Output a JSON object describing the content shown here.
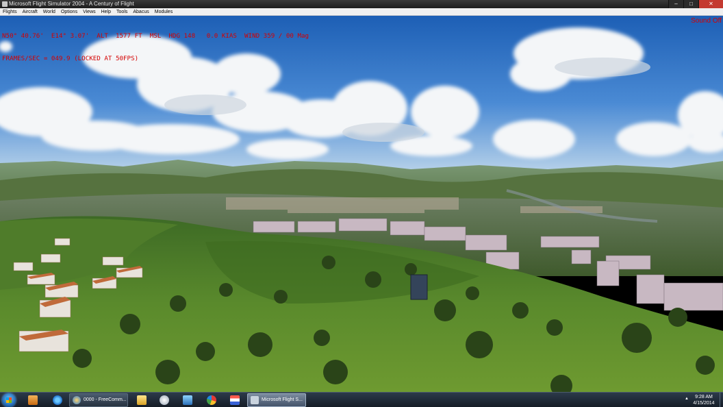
{
  "window": {
    "title": "Microsoft Flight Simulator 2004 - A Century of Flight",
    "minimize": "–",
    "maximize": "□",
    "close": "✕"
  },
  "menu": [
    "Flights",
    "Aircraft",
    "World",
    "Options",
    "Views",
    "Help",
    "Tools",
    "Abacus",
    "Modules"
  ],
  "hud": {
    "line1": "N50° 40.76'  E14° 3.07'  ALT  1577 FT  MSL  HDG 148   0.0 KIAS  WIND 359 / 00 Mag",
    "line2": "FRAMES/SEC = 049.9 (LOCKED AT 50FPS)",
    "sound": "Sound Off",
    "color": "#d40000"
  },
  "taskbar": {
    "start_icon": "windows-orb-icon",
    "pinned": [
      "media-player-icon",
      "internet-explorer-icon"
    ],
    "tasks": [
      {
        "label": "0000 - FreeComm...",
        "icon": "freecomm-icon"
      },
      {
        "label": "Microsoft Flight S...",
        "icon": "airplane-icon"
      }
    ],
    "apps": [
      "folder-icon",
      "globe-icon",
      "monitor-icon",
      "paint-icon",
      "flag-icon"
    ],
    "clock": {
      "time": "9:28 AM",
      "date": "4/15/2014"
    },
    "tray_arrow": "▲"
  }
}
